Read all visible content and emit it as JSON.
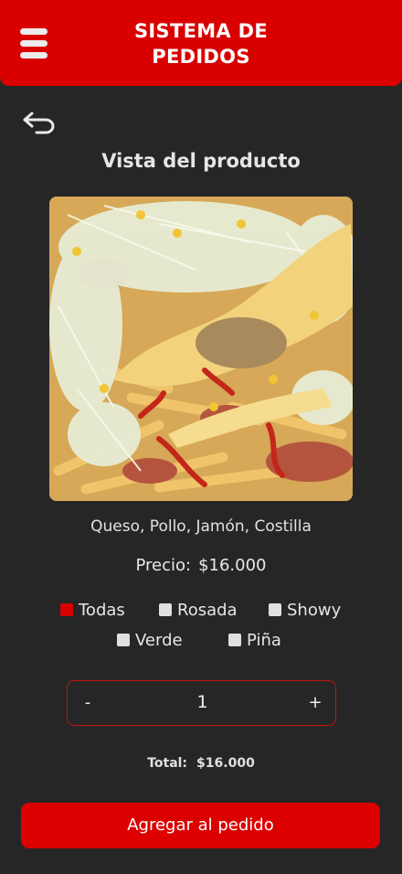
{
  "header": {
    "title_line1": "SISTEMA DE",
    "title_line2": "PEDIDOS",
    "menu_icon": "hamburger-menu-icon"
  },
  "navigation": {
    "back_icon": "back-arrow-icon"
  },
  "page": {
    "title": "Vista del producto"
  },
  "product": {
    "ingredients": "Queso, Pollo, Jamón, Costilla",
    "price_label": "Precio:",
    "price_value": "$16.000"
  },
  "sauces": [
    {
      "label": "Todas",
      "checked": true
    },
    {
      "label": "Rosada",
      "checked": false
    },
    {
      "label": "Showy",
      "checked": false
    },
    {
      "label": "Verde",
      "checked": false
    },
    {
      "label": "Piña",
      "checked": false
    }
  ],
  "quantity": {
    "minus_label": "-",
    "value": "1",
    "plus_label": "+"
  },
  "total": {
    "label": "Total:",
    "value": "$16.000"
  },
  "actions": {
    "add_label": "Agregar al pedido"
  },
  "colors": {
    "accent": "#d90000",
    "background": "#262626"
  }
}
